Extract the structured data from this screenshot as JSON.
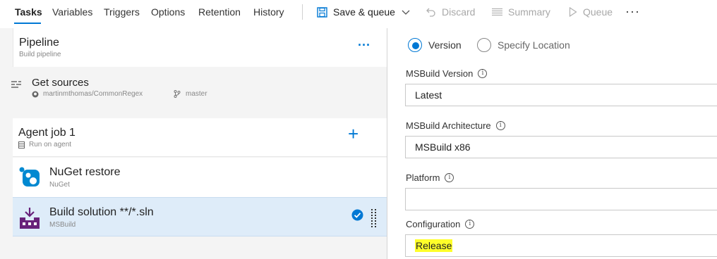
{
  "tabs": [
    {
      "label": "Tasks",
      "active": true
    },
    {
      "label": "Variables"
    },
    {
      "label": "Triggers"
    },
    {
      "label": "Options"
    },
    {
      "label": "Retention"
    },
    {
      "label": "History"
    }
  ],
  "toolbar": {
    "save_queue": "Save & queue",
    "discard": "Discard",
    "summary": "Summary",
    "queue": "Queue",
    "more": "···"
  },
  "pipeline": {
    "title": "Pipeline",
    "subtitle": "Build pipeline",
    "more": "···"
  },
  "get_sources": {
    "title": "Get sources",
    "repo": "martinmthomas/CommonRegex",
    "branch": "master"
  },
  "agent_job": {
    "title": "Agent job 1",
    "subtitle": "Run on agent",
    "add": "+"
  },
  "tasks": [
    {
      "title": "NuGet restore",
      "subtitle": "NuGet"
    },
    {
      "title": "Build solution **/*.sln",
      "subtitle": "MSBuild",
      "selected": true
    }
  ],
  "settings": {
    "radio_version": "Version",
    "radio_location": "Specify Location",
    "msbuild_version_label": "MSBuild Version",
    "msbuild_version_value": "Latest",
    "msbuild_arch_label": "MSBuild Architecture",
    "msbuild_arch_value": "MSBuild x86",
    "platform_label": "Platform",
    "platform_value": "",
    "configuration_label": "Configuration",
    "configuration_value": "Release"
  },
  "colors": {
    "accent": "#0078d4",
    "selected_row": "#deecf9",
    "highlight": "#ffff2a",
    "msbuild_icon": "#68217a"
  },
  "icons": {
    "save": "save-icon",
    "discard": "undo-icon",
    "summary": "list-icon",
    "queue": "play-icon",
    "sources": "source-list-icon",
    "repo": "github-icon",
    "branch": "branch-icon",
    "agent": "server-icon",
    "nuget": "nuget-icon",
    "msbuild": "msbuild-icon",
    "check": "check-circle-icon",
    "grip": "drag-handle-icon",
    "info": "info-icon"
  }
}
